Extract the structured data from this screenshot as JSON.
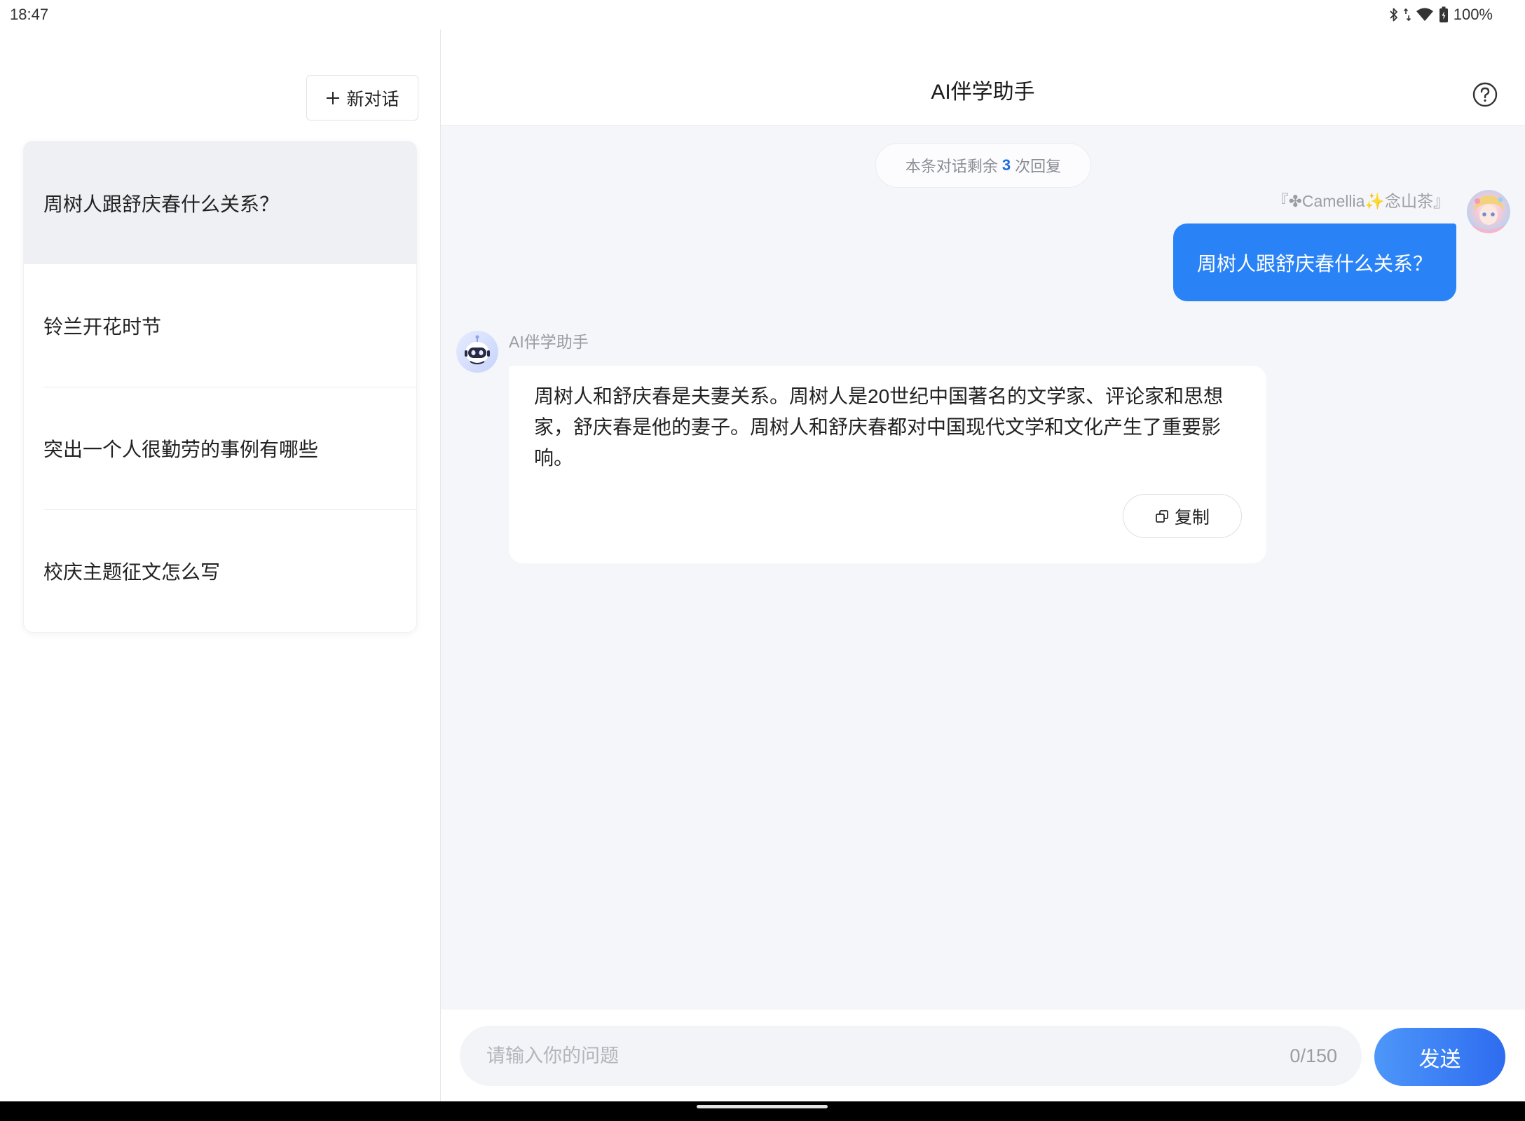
{
  "status_bar": {
    "time": "18:47",
    "battery": "100%",
    "icons": [
      "bluetooth-icon",
      "data-arrows-icon",
      "wifi-icon",
      "battery-icon"
    ]
  },
  "sidebar": {
    "new_chat_label": "新对话",
    "conversations": [
      {
        "title": "周树人跟舒庆春什么关系？",
        "selected": true
      },
      {
        "title": "铃兰开花时节",
        "selected": false
      },
      {
        "title": "突出一个人很勤劳的事例有哪些",
        "selected": false
      },
      {
        "title": "校庆主题征文怎么写",
        "selected": false
      }
    ]
  },
  "header": {
    "title": "AI伴学助手",
    "help_icon": "help-circle-icon"
  },
  "chat": {
    "remaining": {
      "prefix": "本条对话剩余",
      "count": "3",
      "suffix": "次回复"
    },
    "user_message": {
      "sender": "『✤Camellia✨念山茶』",
      "text": "周树人跟舒庆春什么关系？"
    },
    "assistant_message": {
      "sender": "AI伴学助手",
      "text": "周树人和舒庆春是夫妻关系。周树人是20世纪中国著名的文学家、评论家和思想家，舒庆春是他的妻子。周树人和舒庆春都对中国现代文学和文化产生了重要影响。",
      "copy_label": "复制"
    }
  },
  "composer": {
    "placeholder": "请输入你的问题",
    "counter": "0/150",
    "send_label": "发送"
  },
  "theme": {
    "accent": "#2a83f6",
    "selected_item_bg": "#eef0f4",
    "chat_bg": "#f5f6fa"
  }
}
